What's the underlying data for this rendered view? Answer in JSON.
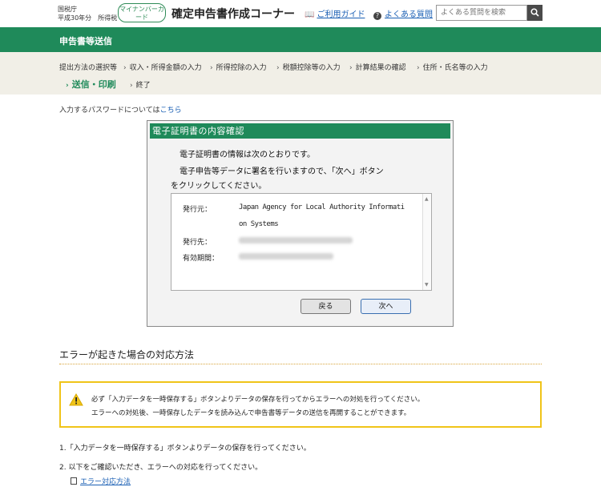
{
  "header": {
    "agency_line1": "国税庁",
    "agency_line2": "平成30年分　所得税",
    "mynumber_badge": "マイナンバーカード",
    "title": "確定申告書作成コーナー",
    "guide_link": "ご利用ガイド",
    "faq_link": "よくある質問",
    "search_placeholder": "よくある質問を検索"
  },
  "section_title": "申告書等送信",
  "steps": {
    "row1": [
      "提出方法の選択等",
      "収入・所得金額の入力",
      "所得控除の入力",
      "税額控除等の入力",
      "計算結果の確認",
      "住所・氏名等の入力"
    ],
    "current": "送信・印刷",
    "last": "終了"
  },
  "password_note": {
    "text": "入力するパスワードについては",
    "link": "こちら"
  },
  "dialog": {
    "title": "電子証明書の内容確認",
    "line1": "電子証明書の情報は次のとおりです。",
    "line2": "電子申告等データに署名を行いますので、「次へ」ボタン",
    "line3": "をクリックしてください。",
    "issuer_label": "発行元：",
    "issuer_value_1": "Japan Agency for Local Authority Informati",
    "issuer_value_2": "on Systems",
    "subject_label": "発行先：",
    "validity_label": "有効期間：",
    "back_button": "戻る",
    "next_button": "次へ"
  },
  "error_section": {
    "heading": "エラーが起きた場合の対応方法",
    "warning_line1": "必ず「入力データを一時保存する」ボタンよりデータの保存を行ってからエラーへの対処を行ってください。",
    "warning_line2": "エラーへの対処後、一時保存したデータを読み込んで申告書等データの送信を再開することができます。",
    "item1": "1.「入力データを一時保存する」ボタンよりデータの保存を行ってください。",
    "item2": "2. 以下をご確認いただき、エラーへの対応を行ってください。",
    "link": "エラー対応方法"
  },
  "colors": {
    "brand_green": "#1f8a5a",
    "warning_yellow": "#f0c419",
    "step_bg": "#f1efe7",
    "link_blue": "#1a5fb4"
  }
}
